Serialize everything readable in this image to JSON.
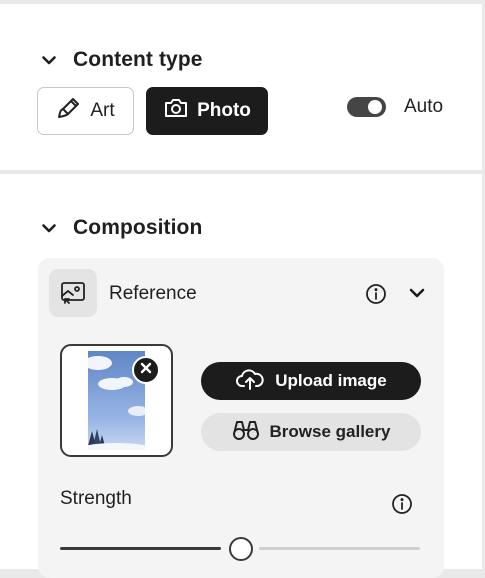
{
  "content_type": {
    "title": "Content type",
    "buttons": [
      {
        "label": "Art",
        "icon": "brush-icon",
        "selected": false
      },
      {
        "label": "Photo",
        "icon": "camera-icon",
        "selected": true
      }
    ],
    "auto_toggle": {
      "label": "Auto",
      "on": true
    }
  },
  "composition": {
    "title": "Composition",
    "reference": {
      "label": "Reference",
      "upload_label": "Upload image",
      "browse_label": "Browse gallery"
    },
    "strength": {
      "label": "Strength",
      "value": 0.5
    }
  },
  "colors": {
    "accent_dark": "#1c1c1c",
    "panel_bg": "#ffffff",
    "card_bg": "#f4f4f4"
  }
}
